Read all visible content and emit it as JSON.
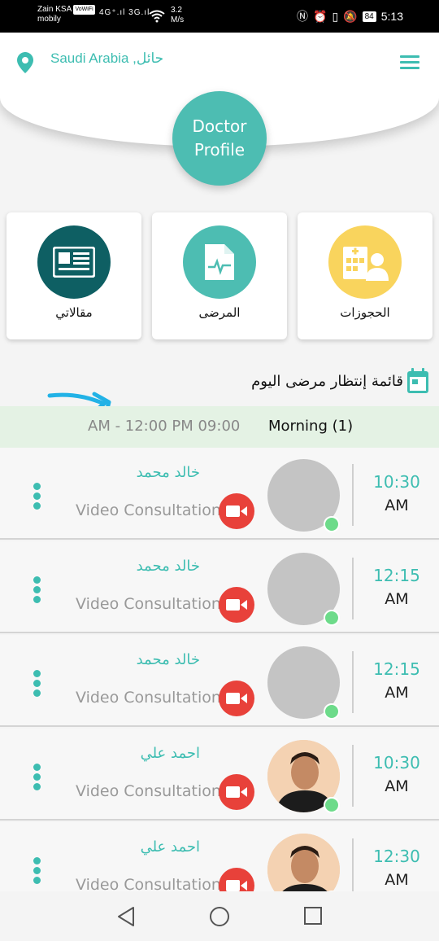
{
  "status_bar": {
    "carrier": "Zain KSA",
    "volte": "VoWiFi",
    "operator2": "mobily",
    "signal": "4G⁺.ıl 3G.ıl",
    "speed_value": "3.2",
    "speed_unit": "M/s",
    "battery": "84",
    "time": "5:13"
  },
  "header": {
    "location": "Saudi Arabia ,حائل",
    "profile_button": "Doctor Profile"
  },
  "cards": [
    {
      "label": "مقالاتي",
      "icon": "newspaper-icon",
      "color": "#0e5f63"
    },
    {
      "label": "المرضى",
      "icon": "medical-file-icon",
      "color": "#4dbdb2"
    },
    {
      "label": "الحجوزات",
      "icon": "hospital-doctor-icon",
      "color": "#f9d45d"
    }
  ],
  "section": {
    "title": "قائمة إنتظار مرضى اليوم",
    "icon": "calendar-icon"
  },
  "shift": {
    "time_range": "AM  -  12:00 PM 09:00",
    "name": "Morning (1)"
  },
  "appointments": [
    {
      "name": "خالد محمد",
      "type": "Video Consultation",
      "time": "10:30",
      "ampm": "AM",
      "avatar": "placeholder"
    },
    {
      "name": "خالد محمد",
      "type": "Video Consultation",
      "time": "12:15",
      "ampm": "AM",
      "avatar": "placeholder"
    },
    {
      "name": "خالد محمد",
      "type": "Video Consultation",
      "time": "12:15",
      "ampm": "AM",
      "avatar": "placeholder"
    },
    {
      "name": "احمد علي",
      "type": "Video Consultation",
      "time": "10:30",
      "ampm": "AM",
      "avatar": "photo"
    },
    {
      "name": "احمد علي",
      "type": "Video Consultation",
      "time": "12:30",
      "ampm": "AM",
      "avatar": "photo"
    }
  ],
  "colors": {
    "accent": "#3dbdb1",
    "video": "#e8413a",
    "online": "#6ddb8a",
    "shift_bg": "#e4f2e4"
  }
}
